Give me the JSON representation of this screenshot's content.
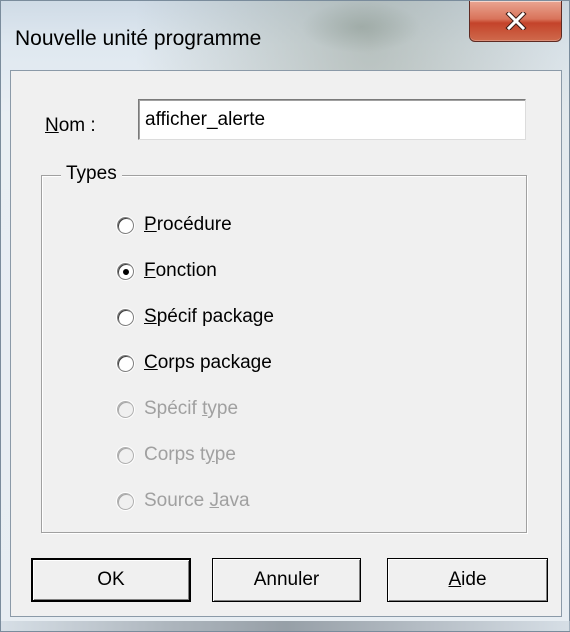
{
  "window": {
    "title": "Nouvelle unité programme",
    "close_icon": "close-icon",
    "close_color": "#c4432a"
  },
  "name": {
    "label_mnemonic": "N",
    "label_rest": "om :",
    "value": "afficher_alerte"
  },
  "types": {
    "title": "Types",
    "options": [
      {
        "pre": "",
        "mnemonic": "P",
        "post": "rocédure",
        "checked": false,
        "enabled": true
      },
      {
        "pre": "",
        "mnemonic": "F",
        "post": "onction",
        "checked": true,
        "enabled": true
      },
      {
        "pre": "",
        "mnemonic": "S",
        "post": "pécif package",
        "checked": false,
        "enabled": true
      },
      {
        "pre": "",
        "mnemonic": "C",
        "post": "orps package",
        "checked": false,
        "enabled": true
      },
      {
        "pre": "Spécif ",
        "mnemonic": "t",
        "post": "ype",
        "checked": false,
        "enabled": false
      },
      {
        "pre": "Corps t",
        "mnemonic": "y",
        "post": "pe",
        "checked": false,
        "enabled": false
      },
      {
        "pre": "Source ",
        "mnemonic": "J",
        "post": "ava",
        "checked": false,
        "enabled": false
      }
    ]
  },
  "buttons": {
    "ok": "OK",
    "cancel": "Annuler",
    "help_mnemonic": "A",
    "help_rest": "ide"
  }
}
